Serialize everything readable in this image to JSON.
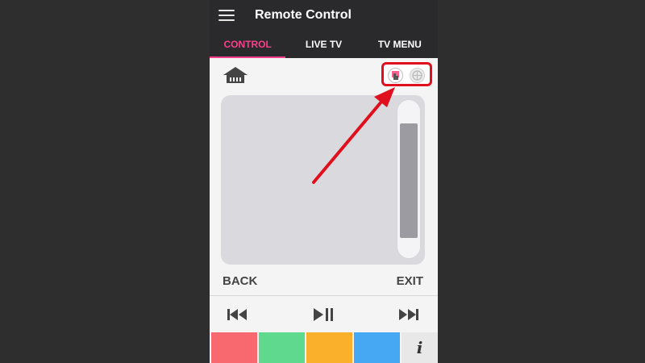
{
  "app": {
    "title": "Remote Control"
  },
  "tabs": [
    {
      "label": "CONTROL",
      "active": true
    },
    {
      "label": "LIVE TV",
      "active": false
    },
    {
      "label": "TV MENU",
      "active": false
    }
  ],
  "controls": {
    "back_label": "BACK",
    "exit_label": "EXIT",
    "info_label": "i"
  },
  "icons": {
    "menu": "hamburger-icon",
    "home": "home-icon",
    "touch_mode": "touch-mode-icon",
    "dpad_mode": "dpad-mode-icon",
    "rewind": "rewind-icon",
    "play_pause": "play-pause-icon",
    "fast_forward": "fast-forward-icon"
  },
  "color_keys": [
    {
      "name": "red",
      "color": "#f8686f"
    },
    {
      "name": "green",
      "color": "#5ed98d"
    },
    {
      "name": "yellow",
      "color": "#fbb02b"
    },
    {
      "name": "blue",
      "color": "#46a8f3"
    }
  ],
  "colors": {
    "accent": "#ff3e8b",
    "appbar": "#2a2a2c",
    "highlight": "#e00f1e",
    "touchpad": "#dadade",
    "scroll_thumb": "#9b9ba1"
  },
  "scroll_position": 0.5
}
